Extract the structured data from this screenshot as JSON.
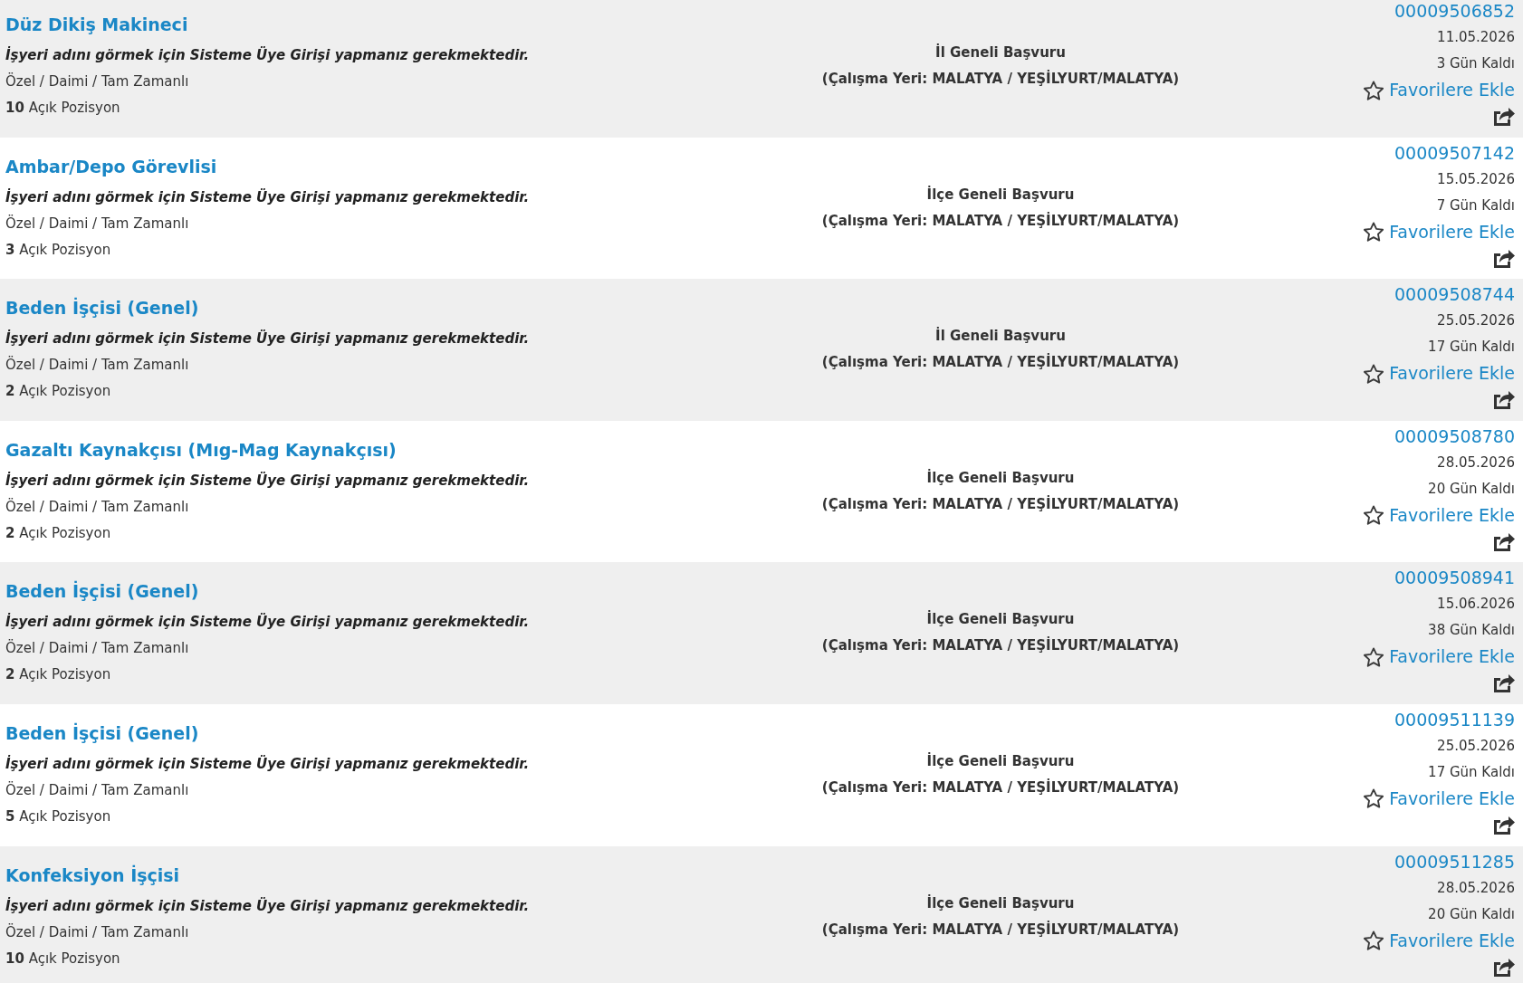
{
  "listings": [
    {
      "title": "Düz Dikiş Makineci",
      "employer_notice": "İşyeri adını görmek için Sisteme Üye Girişi yapmanız gerekmektedir.",
      "employment_type": "Özel / Daimi / Tam Zamanlı",
      "open_positions": "**10** Açık Pozisyon",
      "application_scope": "İl Geneli Başvuru",
      "work_location": "(Çalışma Yeri: MALATYA / YEŞİLYURT/MALATYA)",
      "listing_number": "00009506852",
      "deadline": "11.05.2026",
      "days_left": "3 Gün Kaldı",
      "favorite_label": "Favorilere Ekle"
    },
    {
      "title": "Ambar/Depo Görevlisi",
      "employer_notice": "İşyeri adını görmek için Sisteme Üye Girişi yapmanız gerekmektedir.",
      "employment_type": "Özel / Daimi / Tam Zamanlı",
      "open_positions": "**3** Açık Pozisyon",
      "application_scope": "İlçe Geneli Başvuru",
      "work_location": "(Çalışma Yeri: MALATYA / YEŞİLYURT/MALATYA)",
      "listing_number": "00009507142",
      "deadline": "15.05.2026",
      "days_left": "7 Gün Kaldı",
      "favorite_label": "Favorilere Ekle"
    },
    {
      "title": "Beden İşçisi (Genel)",
      "employer_notice": "İşyeri adını görmek için Sisteme Üye Girişi yapmanız gerekmektedir.",
      "employment_type": "Özel / Daimi / Tam Zamanlı",
      "open_positions": "**2** Açık Pozisyon",
      "application_scope": "İl Geneli Başvuru",
      "work_location": "(Çalışma Yeri: MALATYA / YEŞİLYURT/MALATYA)",
      "listing_number": "00009508744",
      "deadline": "25.05.2026",
      "days_left": "17 Gün Kaldı",
      "favorite_label": "Favorilere Ekle"
    },
    {
      "title": "Gazaltı Kaynakçısı (Mıg-Mag Kaynakçısı)",
      "employer_notice": "İşyeri adını görmek için Sisteme Üye Girişi yapmanız gerekmektedir.",
      "employment_type": "Özel / Daimi / Tam Zamanlı",
      "open_positions": "**2** Açık Pozisyon",
      "application_scope": "İlçe Geneli Başvuru",
      "work_location": "(Çalışma Yeri: MALATYA / YEŞİLYURT/MALATYA)",
      "listing_number": "00009508780",
      "deadline": "28.05.2026",
      "days_left": "20 Gün Kaldı",
      "favorite_label": "Favorilere Ekle"
    },
    {
      "title": "Beden İşçisi (Genel)",
      "employer_notice": "İşyeri adını görmek için Sisteme Üye Girişi yapmanız gerekmektedir.",
      "employment_type": "Özel / Daimi / Tam Zamanlı",
      "open_positions": "**2** Açık Pozisyon",
      "application_scope": "İlçe Geneli Başvuru",
      "work_location": "(Çalışma Yeri: MALATYA / YEŞİLYURT/MALATYA)",
      "listing_number": "00009508941",
      "deadline": "15.06.2026",
      "days_left": "38 Gün Kaldı",
      "favorite_label": "Favorilere Ekle"
    },
    {
      "title": "Beden İşçisi (Genel)",
      "employer_notice": "İşyeri adını görmek için Sisteme Üye Girişi yapmanız gerekmektedir.",
      "employment_type": "Özel / Daimi / Tam Zamanlı",
      "open_positions": "**5** Açık Pozisyon",
      "application_scope": "İlçe Geneli Başvuru",
      "work_location": "(Çalışma Yeri: MALATYA / YEŞİLYURT/MALATYA)",
      "listing_number": "00009511139",
      "deadline": "25.05.2026",
      "days_left": "17 Gün Kaldı",
      "favorite_label": "Favorilere Ekle"
    },
    {
      "title": "Konfeksiyon İşçisi",
      "employer_notice": "İşyeri adını görmek için Sisteme Üye Girişi yapmanız gerekmektedir.",
      "employment_type": "Özel / Daimi / Tam Zamanlı",
      "open_positions": "**10** Açık Pozisyon",
      "application_scope": "İlçe Geneli Başvuru",
      "work_location": "(Çalışma Yeri: MALATYA / YEŞİLYURT/MALATYA)",
      "listing_number": "00009511285",
      "deadline": "28.05.2026",
      "days_left": "20 Gün Kaldı",
      "favorite_label": "Favorilere Ekle"
    }
  ]
}
